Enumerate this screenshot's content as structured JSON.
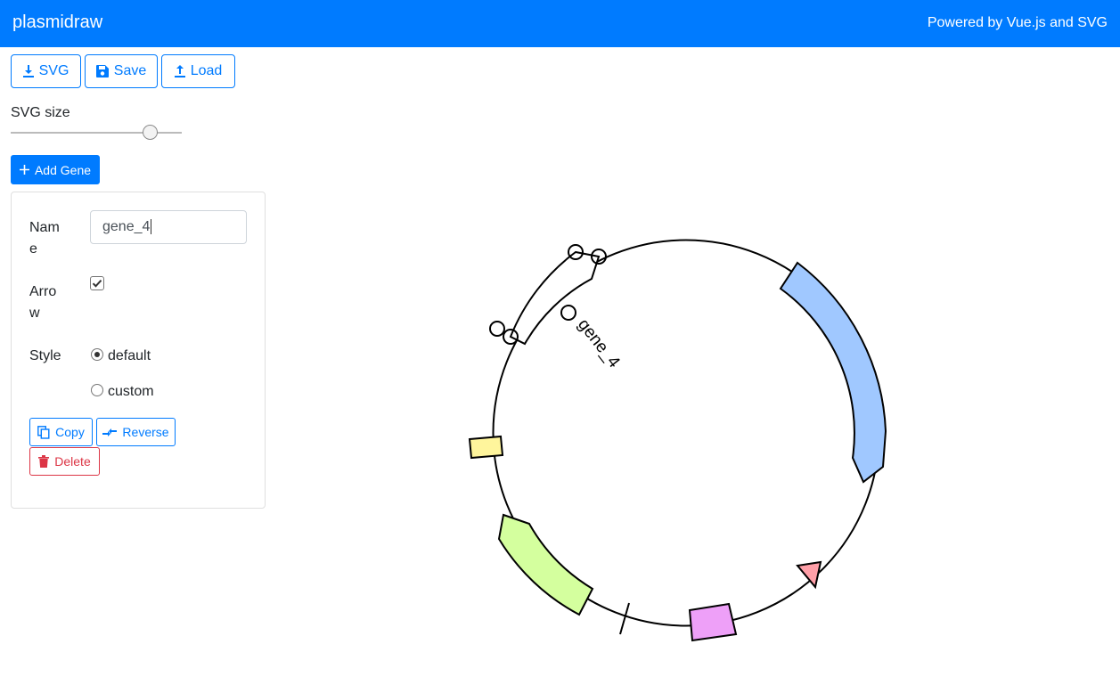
{
  "app": {
    "title": "plasmidraw",
    "powered_by": "Powered by Vue.js and SVG"
  },
  "toolbar": {
    "svg_label": "SVG",
    "save_label": "Save",
    "load_label": "Load"
  },
  "svg_size": {
    "label": "SVG size",
    "value_fraction": 0.82
  },
  "add_gene_label": "Add Gene",
  "gene_editor": {
    "name_label_line1": "Nam",
    "name_label_line2": "e",
    "name_value": "gene_4",
    "arrow_label_line1": "Arro",
    "arrow_label_line2": "w",
    "arrow_checked": true,
    "style_label": "Style",
    "style_options": [
      "default",
      "custom"
    ],
    "style_selected": "default",
    "copy_label": "Copy",
    "reverse_label": "Reverse",
    "delete_label": "Delete"
  },
  "plasmid": {
    "selected_gene_label": "gene_4",
    "feature_colors": {
      "blue": "#a0c8ff",
      "green": "#d4ff9e",
      "yellow": "#fff59c",
      "pink": "#ff9fa8",
      "magenta": "#eea0f8"
    }
  },
  "colors": {
    "primary": "#007bff",
    "danger": "#dc3545"
  }
}
